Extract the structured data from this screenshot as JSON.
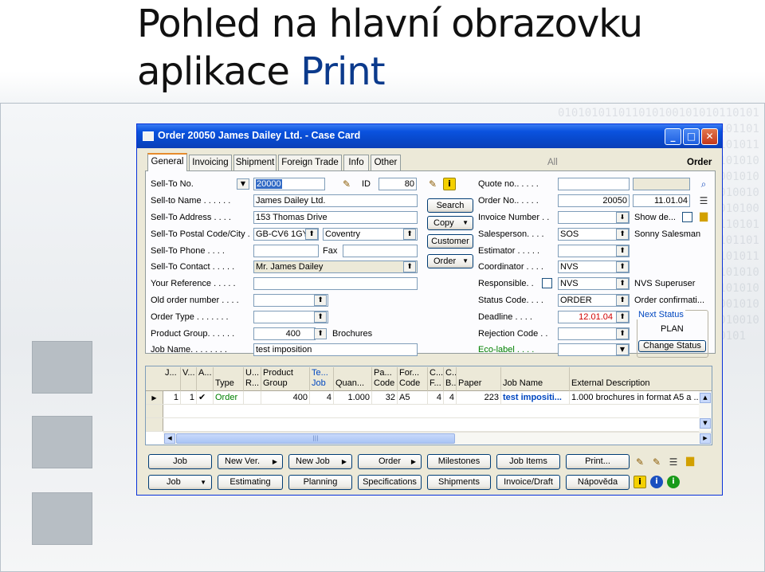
{
  "slide": {
    "title_line1": "Pohled na hlavní obrazovku",
    "title_line2_plain": "aplikace",
    "title_line2_accent": "Print",
    "background_binary": "0101010110110101001010101101010100101010101101010010101011010101001010101011010100101010110101010010101010110101001010101101010100101010101101010010101011010101001010101011010100101010110101010010101010110101001010101101010100101010101101010010101011010101001010101011010100101010110101010010101010110101001010101101010100101010101101010010101011010101001010101011010100101010110101010010101010110101001010101101010100101010101101010010101011010101"
  },
  "window": {
    "title": "Order 20050 James Dailey Ltd. - Case Card",
    "minimize": "_",
    "maximize": "□",
    "close": "✕"
  },
  "tabs": [
    "General",
    "Invoicing",
    "Shipment",
    "Foreign Trade",
    "Info",
    "Other"
  ],
  "tab_all": "All",
  "tab_order": "Order",
  "left": {
    "sell_to_no_label": "Sell-To No.",
    "sell_to_no": "20000",
    "id_label": "ID",
    "id_value": "80",
    "sell_to_name_label": "Sell-to Name . . . . . .",
    "sell_to_name": "James Dailey Ltd.",
    "sell_to_address_label": "Sell-To Address . . . .",
    "sell_to_address": "153 Thomas Drive",
    "postal_label": "Sell-To Postal Code/City .",
    "postal_code": "GB-CV6 1GY",
    "city": "Coventry",
    "phone_label": "Sell-To Phone . . . .",
    "phone": "",
    "fax_label": "Fax",
    "fax": "",
    "contact_label": "Sell-To Contact . . . . .",
    "contact": "Mr. James Dailey",
    "your_ref_label": "Your Reference . . . . .",
    "your_ref": "",
    "old_order_label": "Old order number . . . .",
    "old_order": "",
    "order_type_label": "Order Type . . . . . . .",
    "order_type": "",
    "product_group_label": "Product Group. . . . . .",
    "product_group_no": "400",
    "product_group_name": "Brochures",
    "job_name_label": "Job Name. . . . . . . .",
    "job_name": "test imposition"
  },
  "mid_buttons": {
    "search": "Search",
    "copy": "Copy",
    "customer": "Customer",
    "order": "Order"
  },
  "right": {
    "quote_no_label": "Quote no.. . . . .",
    "quote_no": "",
    "order_no_label": "Order No.. . . . .",
    "order_no": "20050",
    "order_date": "11.01.04",
    "invoice_no_label": "Invoice Number . .",
    "invoice_no": "",
    "show_de": "Show de...",
    "salesperson_label": "Salesperson. . . .",
    "salesperson": "SOS",
    "salesperson_name": "Sonny Salesman",
    "estimator_label": "Estimator . . . . .",
    "estimator": "",
    "coordinator_label": "Coordinator . . . .",
    "coordinator": "NVS",
    "responsible_label": "Responsible. .",
    "responsible": "NVS",
    "responsible_name": "NVS Superuser",
    "status_code_label": "Status Code. . . .",
    "status_code": "ORDER",
    "status_desc": "Order confirmati...",
    "deadline_label": "Deadline . . . .",
    "deadline": "12.01.04",
    "rejection_label": "Rejection Code . .",
    "rejection": "",
    "eco_label": "Eco-label . . . .",
    "eco": "",
    "next_status_label": "Next Status",
    "next_status": "PLAN",
    "change_status": "Change Status"
  },
  "grid": {
    "headers": [
      "J...",
      "V...",
      "A...",
      "Type",
      "U... R...",
      "Product Group",
      "Te... Job",
      "Quan...",
      "Pa... Code",
      "For... Code",
      "C... F...",
      "C... B...",
      "Paper",
      "Job Name",
      "External Description"
    ],
    "rows": [
      [
        "1",
        "1",
        "✔",
        "Order",
        "",
        "400",
        "4",
        "1.000",
        "32",
        "A5",
        "4",
        "4",
        "223",
        "test impositi...",
        "1.000 brochures in format A5 a ..."
      ]
    ]
  },
  "bottom_buttons": {
    "row1": [
      "Job",
      "New Ver.",
      "New Job",
      "Order",
      "Milestones",
      "Job Items",
      "Print..."
    ],
    "row2": [
      "Job",
      "Estimating",
      "Planning",
      "Specifications",
      "Shipments",
      "Invoice/Draft",
      "Nápověda"
    ]
  },
  "colors": {
    "titlebar": "#0a52df",
    "window_bg": "#ece9d8",
    "label_green": "#008000",
    "link_blue": "#0047c0",
    "deadline_red": "#d00000",
    "accent_title": "#0b3a8c"
  }
}
